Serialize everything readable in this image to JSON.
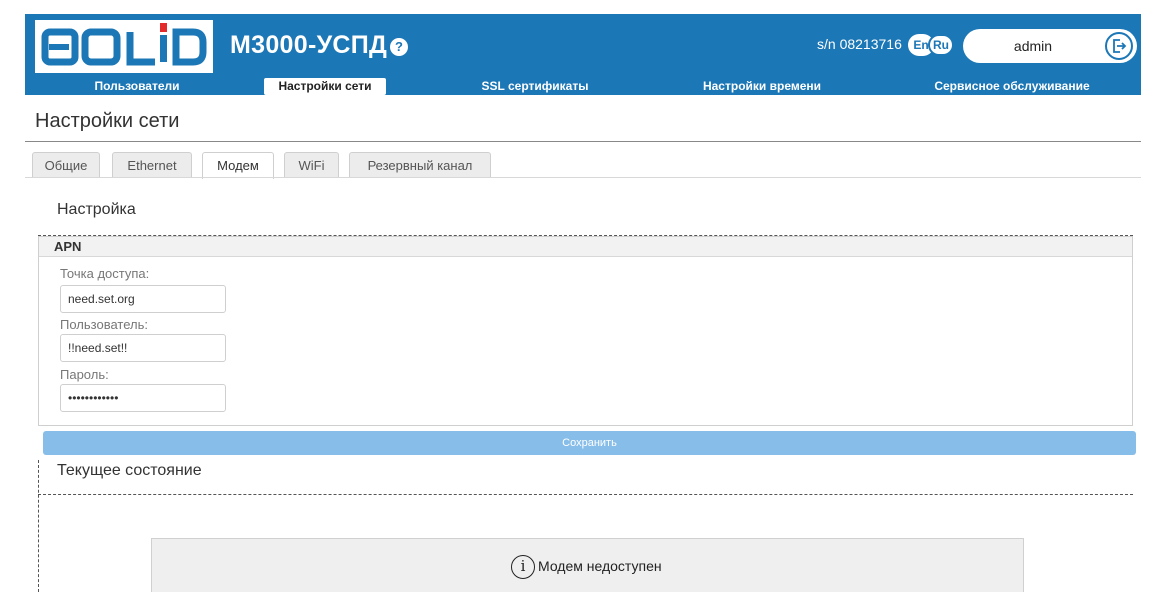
{
  "header": {
    "logo_text": "BOLID",
    "app_title": "М3000-УСПД",
    "help_glyph": "?",
    "serial": "s/n 08213716",
    "lang_en": "En",
    "lang_ru": "Ru",
    "username": "admin",
    "colors": {
      "primary": "#1c77b6",
      "logo_red": "#e42b2b"
    }
  },
  "nav": {
    "items": [
      {
        "label": "Пользователи"
      },
      {
        "label": "Настройки сети",
        "active": true
      },
      {
        "label": "SSL сертификаты"
      },
      {
        "label": "Настройки времени"
      },
      {
        "label": "Сервисное обслуживание"
      }
    ]
  },
  "page": {
    "title": "Настройки сети"
  },
  "tabs": {
    "items": [
      {
        "label": "Общие"
      },
      {
        "label": "Ethernet"
      },
      {
        "label": "Модем",
        "active": true
      },
      {
        "label": "WiFi"
      },
      {
        "label": "Резервный канал"
      }
    ]
  },
  "settings": {
    "section_title": "Настройка",
    "apn": {
      "title": "APN",
      "access_point_label": "Точка доступа:",
      "access_point_value": "need.set.org",
      "user_label": "Пользователь:",
      "user_value": "!!need.set!!",
      "password_label": "Пароль:",
      "password_value": "••••••••••••"
    },
    "save_label": "Сохранить"
  },
  "status": {
    "section_title": "Текущее состояние",
    "info_glyph": "i",
    "message": "Модем недоступен"
  }
}
